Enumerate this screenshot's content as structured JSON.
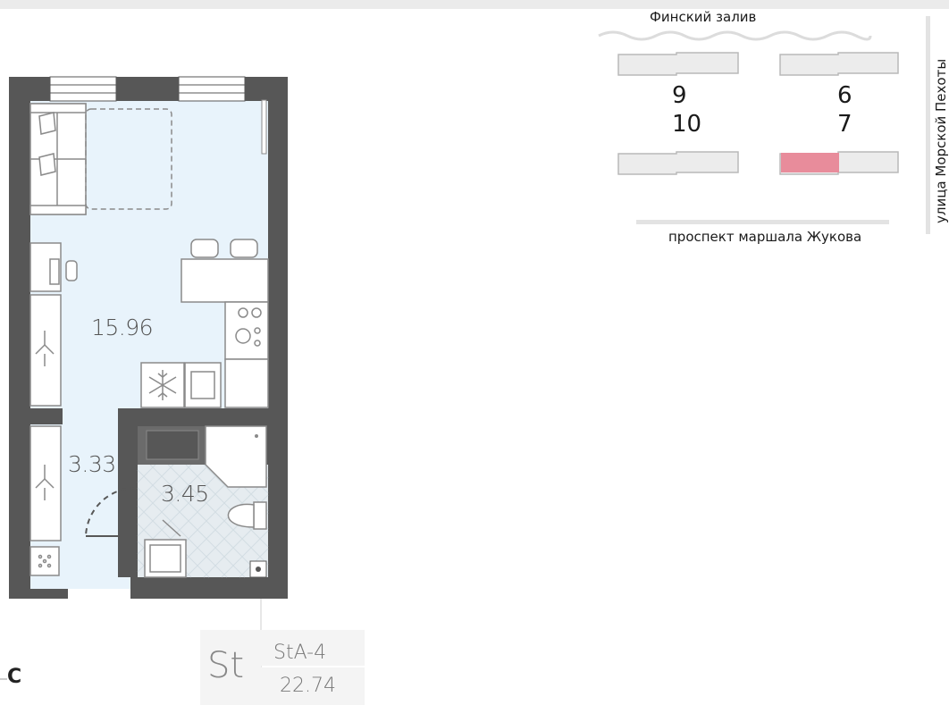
{
  "plan": {
    "rooms": [
      {
        "name": "main-room",
        "area": "15.96"
      },
      {
        "name": "hallway",
        "area": "3.33"
      },
      {
        "name": "bathroom",
        "area": "3.45"
      }
    ]
  },
  "apartment": {
    "type": "St",
    "code": "StA-4",
    "total_area": "22.74"
  },
  "compass": {
    "label": "С"
  },
  "sitemap": {
    "bay_label": "Финский залив",
    "bottom_street": "проспект маршала Жукова",
    "side_street": "улица Морской Пехоты",
    "buildings": [
      {
        "number": "9"
      },
      {
        "number": "6"
      },
      {
        "number": "10"
      },
      {
        "number": "7",
        "highlighted": true
      }
    ],
    "highlight_color": "#e88c9b"
  },
  "colors": {
    "wall": "#575757",
    "floor_main": "#e8f3fb",
    "furniture_stroke": "#8a8a8a",
    "accent_highlight": "#e88c9b"
  }
}
